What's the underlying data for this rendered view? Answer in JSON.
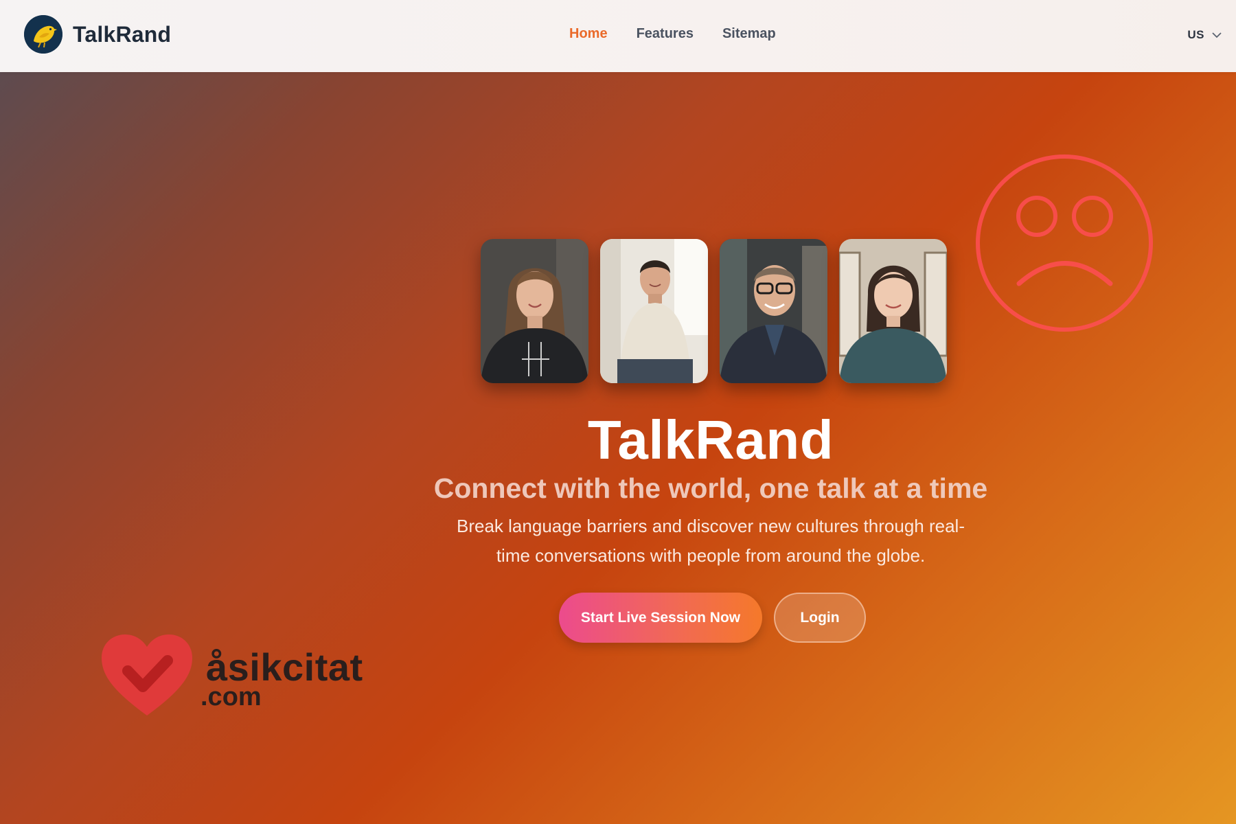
{
  "header": {
    "brand_name": "TalkRand",
    "nav": [
      {
        "label": "Home",
        "active": true
      },
      {
        "label": "Features",
        "active": false
      },
      {
        "label": "Sitemap",
        "active": false
      }
    ],
    "locale": "US"
  },
  "hero": {
    "title": "TalkRand",
    "subtitle": "Connect with the world, one talk at a time",
    "description": "Break language barriers and discover new cultures through real-time conversations with people from around the globe.",
    "primary_cta": "Start Live Session Now",
    "secondary_cta": "Login",
    "profile_photos": [
      "woman-long-hair-photo",
      "young-man-sweater-photo",
      "man-glasses-blazer-photo",
      "woman-short-hair-photo"
    ]
  },
  "watermark": {
    "main": "åsikcitat",
    "sub": ".com"
  },
  "colors": {
    "accent_active_nav": "#ea6a2a",
    "sad_face": "#ff4d55",
    "primary_gradient_start": "#ec4b8d",
    "primary_gradient_end": "#f5792a"
  }
}
